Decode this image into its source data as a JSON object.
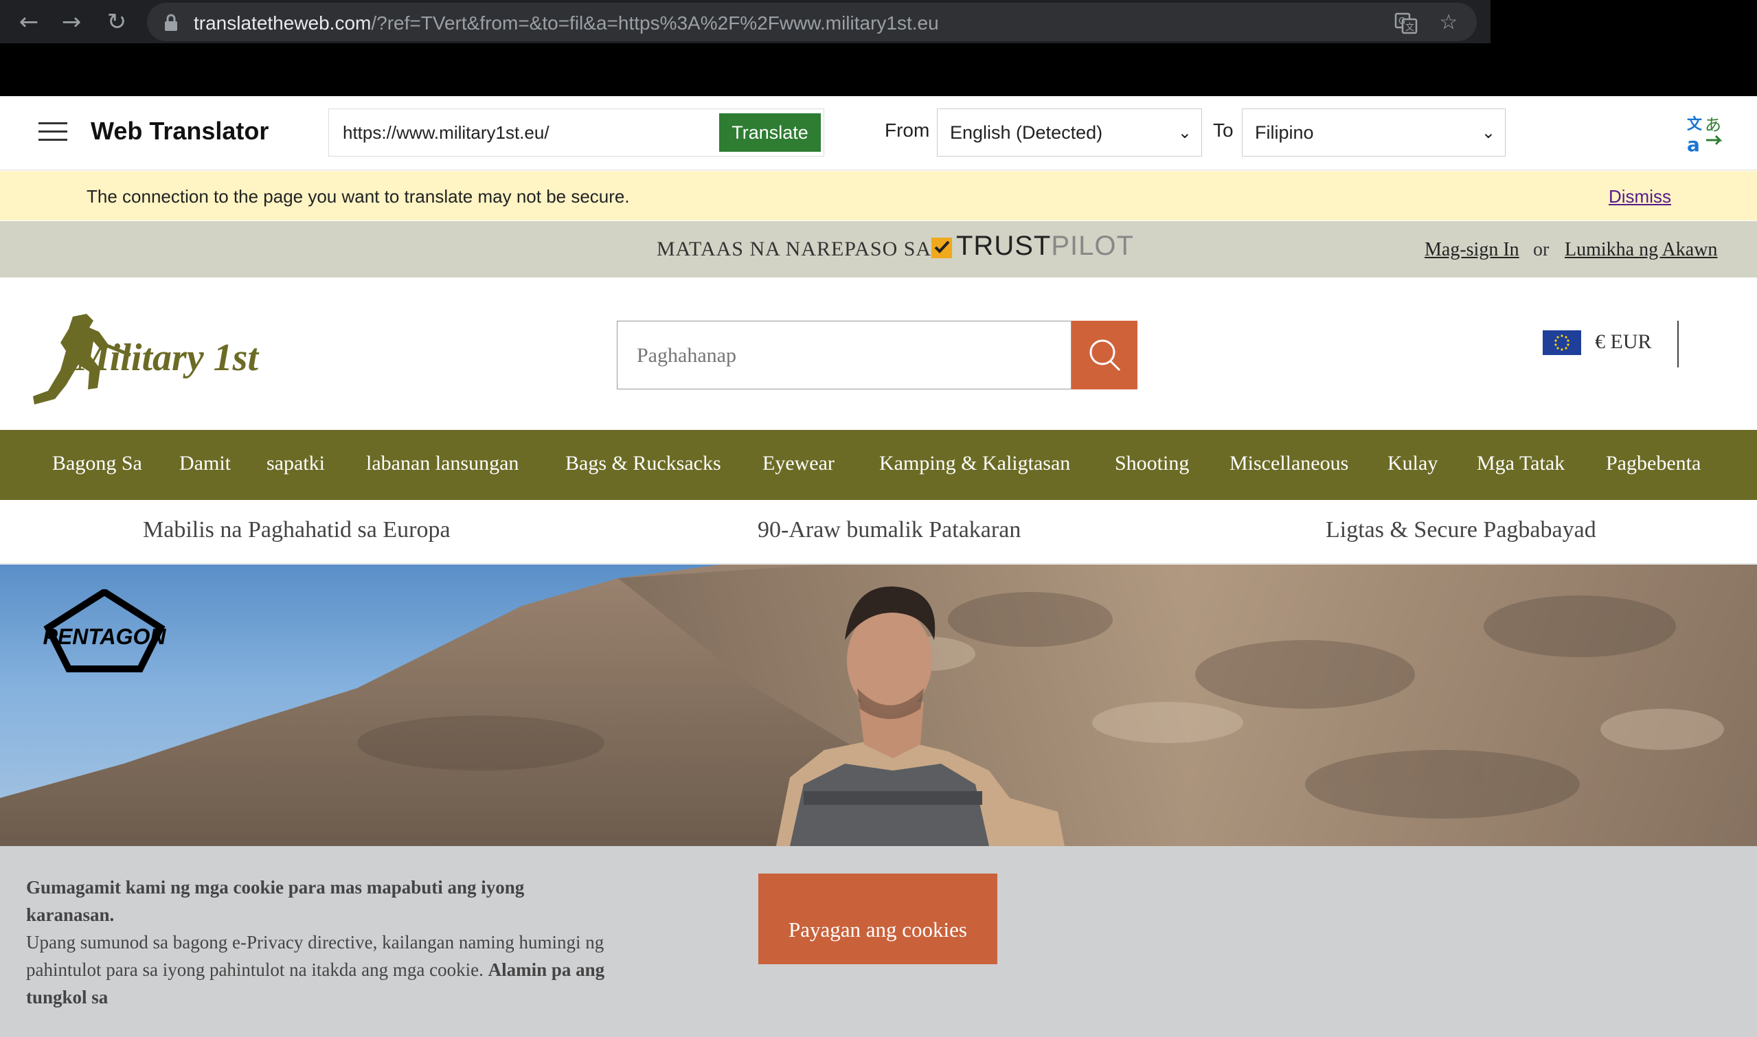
{
  "browser": {
    "url_host": "translatetheweb.com",
    "url_rest": "/?ref=TVert&from=&to=fil&a=https%3A%2F%2Fwww.military1st.eu"
  },
  "translator": {
    "title": "Web Translator",
    "url_value": "https://www.military1st.eu/",
    "translate_label": "Translate",
    "from_label": "From",
    "from_value": "English (Detected)",
    "to_label": "To",
    "to_value": "Filipino",
    "accent_color": "#2e7d32"
  },
  "warning": {
    "text": "The connection to the page you want to translate may not be secure.",
    "dismiss": "Dismiss"
  },
  "topbar": {
    "review_text": "MATAAS NA NAREPASO SA",
    "trust": "TRUST",
    "pilot": "PILOT",
    "signin": "Mag-sign In",
    "or": "or",
    "create_account": "Lumikha ng Akawn"
  },
  "header": {
    "search_placeholder": "Paghahanap",
    "currency": "€ EUR",
    "logo_text": "Military 1st"
  },
  "nav": {
    "items": [
      "Bagong Sa",
      "Damit",
      "sapatki",
      "labanan lansungan",
      "Bags & Rucksacks",
      "Eyewear",
      "Kamping & Kaligtasan",
      "Shooting",
      "Miscellaneous",
      "Kulay",
      "Mga Tatak",
      "Pagbebenta"
    ]
  },
  "usp": {
    "items": [
      "Mabilis na Paghahatid sa Europa",
      "90-Araw bumalik Patakaran",
      "Ligtas & Secure Pagbabayad"
    ]
  },
  "hero": {
    "brand": "PENTAGON"
  },
  "cookie": {
    "title": "Gumagamit kami ng mga cookie para mas mapabuti ang iyong karanasan.",
    "body": "Upang sumunod sa bagong e-Privacy directive, kailangan naming humingi ng pahintulot para sa iyong pahintulot na itakda ang mga cookie.",
    "learn_more": "Alamin pa ang tungkol sa",
    "allow_button": "Payagan ang cookies"
  }
}
